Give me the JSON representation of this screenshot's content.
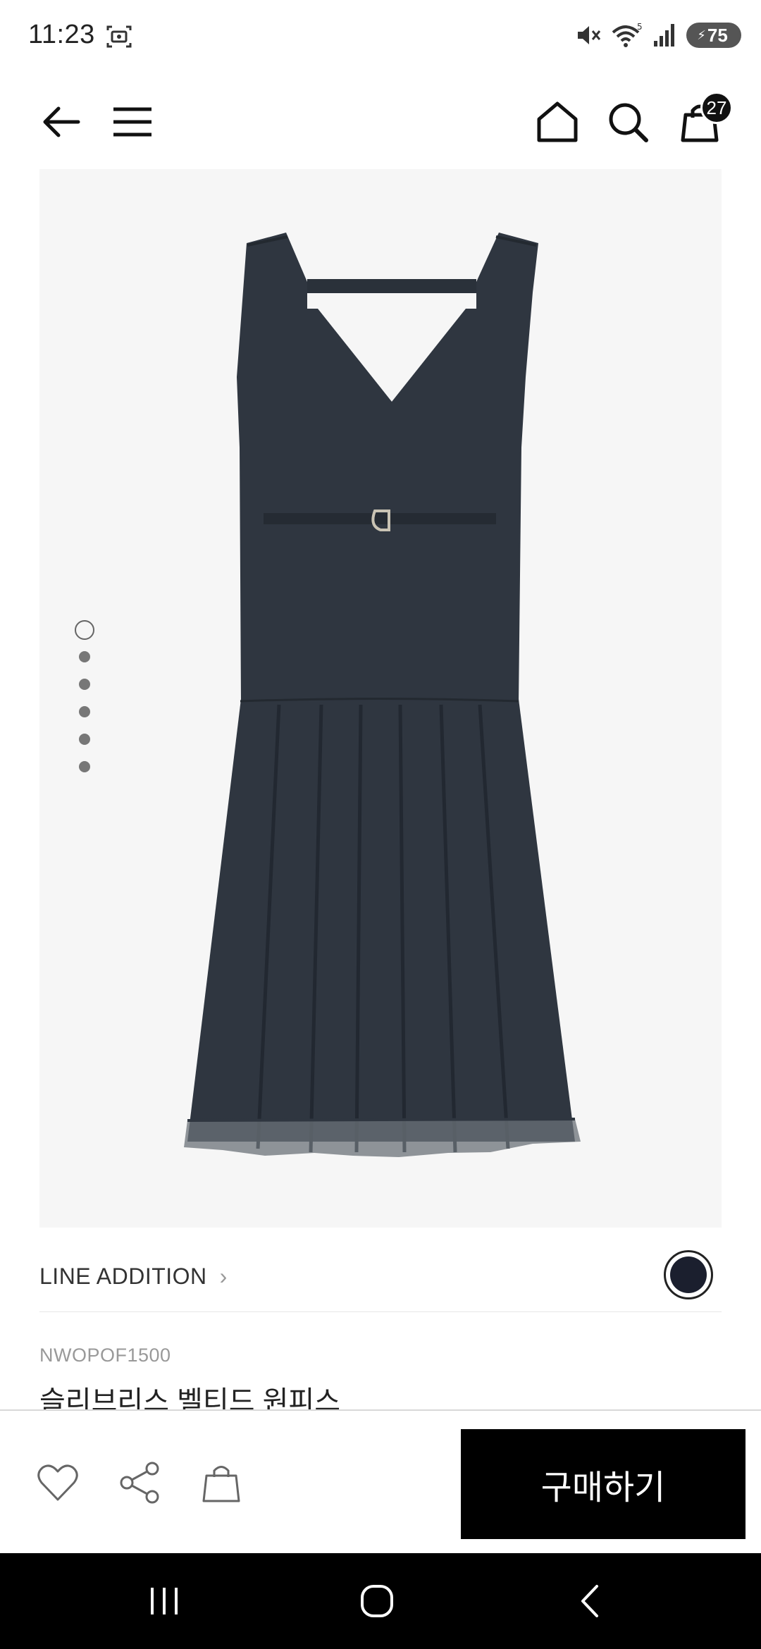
{
  "status_bar": {
    "time": "11:23",
    "battery": "75",
    "wifi_label": "5"
  },
  "header": {
    "cart_count": "27"
  },
  "gallery": {
    "image_count": 6,
    "active_index": 0,
    "dress_color": "#2f3640",
    "background": "#f6f6f6"
  },
  "product": {
    "brand": "LINE ADDITION",
    "code": "NWOPOF1500",
    "name": "슬리브리스 벨티드 원피스",
    "swatch_color": "#1b1f2e"
  },
  "actions": {
    "buy_label": "구매하기"
  },
  "icons": {
    "back": "arrow-left-icon",
    "menu": "hamburger-menu-icon",
    "home": "home-icon",
    "search": "search-icon",
    "bag": "shopping-bag-icon",
    "heart": "heart-icon",
    "share": "share-icon"
  }
}
